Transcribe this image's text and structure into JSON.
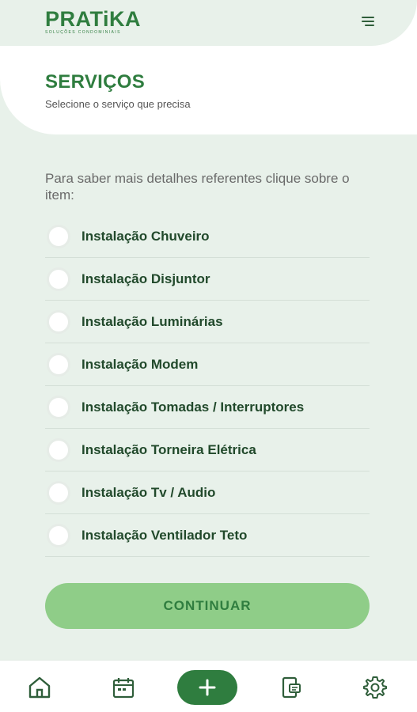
{
  "brand": {
    "name": "PRATiKA",
    "tagline": "SOLUÇÕES CONDOMINIAIS",
    "primary_color": "#2f7d3f",
    "accent_color": "#8fcd88",
    "background_color": "#e8f1ea"
  },
  "header": {
    "menu_icon": "hamburger-menu-icon"
  },
  "page": {
    "title": "SERVIÇOS",
    "subtitle": "Selecione o serviço que precisa",
    "intro": "Para saber mais detalhes referentes clique sobre o item:"
  },
  "services": [
    {
      "label": "Instalação Chuveiro",
      "selected": false
    },
    {
      "label": "Instalação Disjuntor",
      "selected": false
    },
    {
      "label": "Instalação Luminárias",
      "selected": false
    },
    {
      "label": "Instalação Modem",
      "selected": false
    },
    {
      "label": "Instalação Tomadas / Interruptores",
      "selected": false
    },
    {
      "label": "Instalação Torneira Elétrica",
      "selected": false
    },
    {
      "label": "Instalação Tv / Audio",
      "selected": false
    },
    {
      "label": "Instalação Ventilador Teto",
      "selected": false
    }
  ],
  "actions": {
    "continue_label": "CONTINUAR"
  },
  "bottom_nav": [
    {
      "icon": "home-icon"
    },
    {
      "icon": "calendar-icon"
    },
    {
      "icon": "plus-icon"
    },
    {
      "icon": "document-icon"
    },
    {
      "icon": "gear-icon"
    }
  ]
}
